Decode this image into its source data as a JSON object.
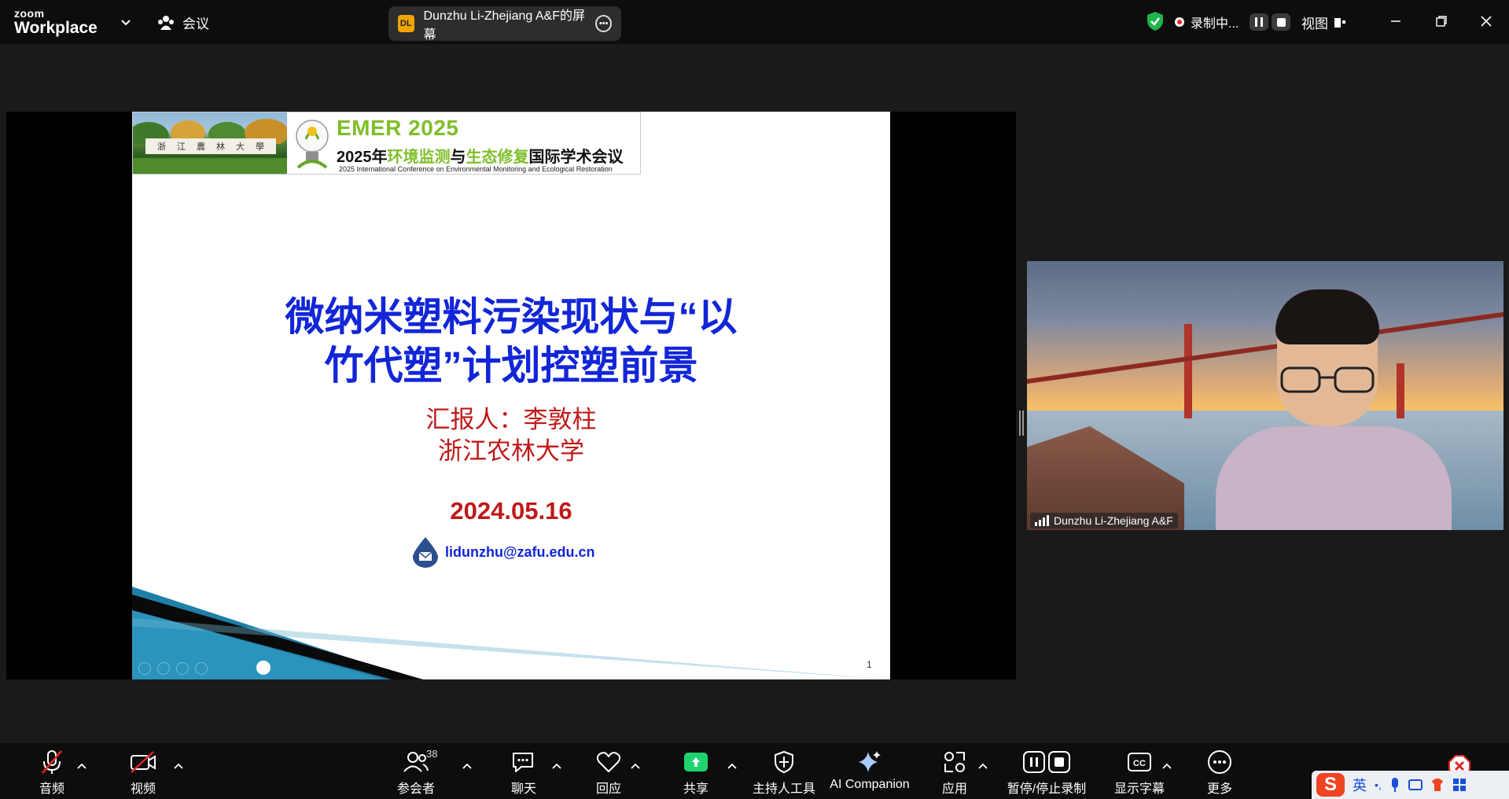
{
  "app": {
    "brand_small": "zoom",
    "brand_big": "Workplace",
    "meetings_label": "会议"
  },
  "share_banner": {
    "badge": "DL",
    "title": "Dunzhu Li-Zhejiang A&F的屏幕"
  },
  "recording": {
    "label": "录制中...",
    "view_label": "视图"
  },
  "slide": {
    "banner_title": "EMER 2025",
    "banner_cn": [
      "2025年",
      "环境监测",
      "与",
      "生态修复",
      "国际学术会议"
    ],
    "banner_en": "2025 International Conference on Environmental Monitoring and Ecological Restoration",
    "sign_text": [
      "浙",
      "江",
      "農",
      "林",
      "大",
      "學"
    ],
    "title_line1": "微纳米塑料污染现状与“以",
    "title_line2": "竹代塑”计划控塑前景",
    "reporter": "汇报人：李敦柱",
    "university": "浙江农林大学",
    "date": "2024.05.16",
    "email": "lidunzhu@zafu.edu.cn",
    "page_number": "1"
  },
  "video": {
    "participant_name": "Dunzhu Li-Zhejiang A&F"
  },
  "toolbar": {
    "audio": "音频",
    "video": "视频",
    "participants": "参会者",
    "participants_count": "38",
    "chat": "聊天",
    "reactions": "回应",
    "share": "共享",
    "host_tools": "主持人工具",
    "ai_companion": "AI Companion",
    "apps": "应用",
    "pause_stop_recording": "暂停/停止录制",
    "captions": "显示字幕",
    "more": "更多"
  },
  "ime": {
    "lang": "英"
  },
  "colors": {
    "slide_title": "#1226d8",
    "slide_red": "#c01818",
    "share_green": "#1fd371",
    "banner_green": "#7fbf2a"
  }
}
